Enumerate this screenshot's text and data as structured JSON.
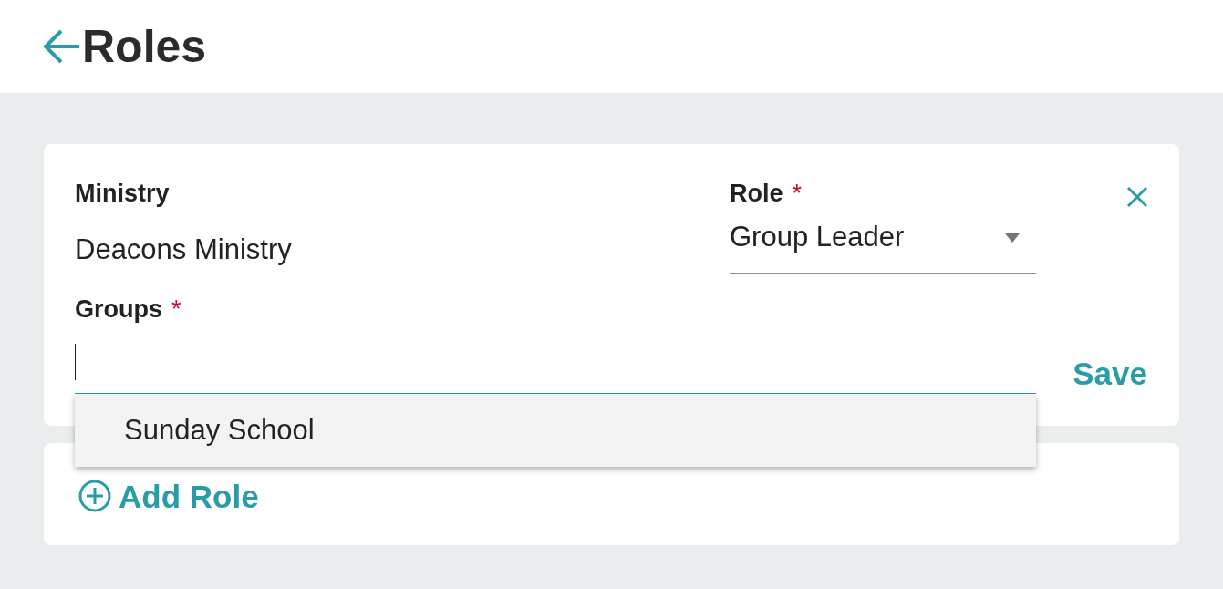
{
  "header": {
    "title": "Roles"
  },
  "role_form": {
    "ministry": {
      "label": "Ministry",
      "value": "Deacons Ministry"
    },
    "role": {
      "label": "Role",
      "required_mark": "*",
      "value": "Group Leader"
    },
    "groups": {
      "label": "Groups",
      "required_mark": "*",
      "focused": true,
      "suggestions": [
        {
          "label": "Sunday School",
          "selected": false
        }
      ]
    },
    "save_button": "Save"
  },
  "add_role_button": "Add Role"
}
